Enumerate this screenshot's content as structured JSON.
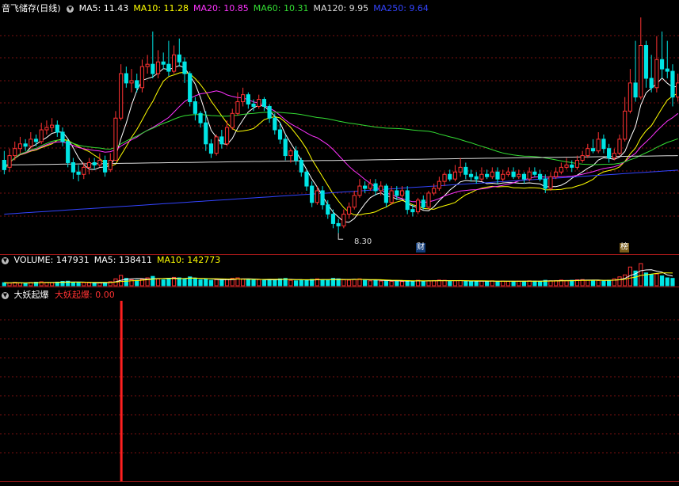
{
  "title": "音飞储存(日线)",
  "ma_legend": [
    {
      "label": "MA5: 11.43",
      "color": "#ffffff"
    },
    {
      "label": "MA10: 11.28",
      "color": "#ffff00"
    },
    {
      "label": "MA20: 10.85",
      "color": "#ff33ff"
    },
    {
      "label": "MA60: 10.31",
      "color": "#33dd33"
    },
    {
      "label": "MA120: 9.95",
      "color": "#dddddd"
    },
    {
      "label": "MA250: 9.64",
      "color": "#3344ff"
    }
  ],
  "low_label": "8.30",
  "markers": {
    "cai": "财",
    "bang": "榜"
  },
  "volume_legend": [
    {
      "label": "VOLUME: 147931",
      "color": "#ffffff"
    },
    {
      "label": "MA5: 138411",
      "color": "#ffffff"
    },
    {
      "label": "MA10: 142773",
      "color": "#ffff00"
    }
  ],
  "indicator_legend": {
    "name": "大妖起爆",
    "value_label": "大妖起爆: 0.00"
  },
  "colors": {
    "up": "#ff3232",
    "down": "#00e5e5",
    "grid": "#7a1010",
    "border": "#a01818"
  },
  "chart_data": [
    {
      "type": "candlestick",
      "title": "音飞储存(日线)",
      "ylim": [
        8.0,
        12.9
      ],
      "low": 8.3,
      "moving_averages": {
        "MA5": 11.43,
        "MA10": 11.28,
        "MA20": 10.85,
        "MA60": 10.31,
        "MA120": 9.95,
        "MA250": 9.64
      },
      "candles": [
        [
          9.85,
          9.65,
          10.05,
          9.55
        ],
        [
          9.7,
          9.95,
          10.1,
          9.6
        ],
        [
          9.95,
          10.1,
          10.25,
          9.85
        ],
        [
          10.1,
          10.2,
          10.35,
          10.0
        ],
        [
          10.2,
          10.15,
          10.3,
          10.05
        ],
        [
          10.15,
          10.3,
          10.45,
          10.1
        ],
        [
          10.3,
          10.25,
          10.4,
          10.15
        ],
        [
          10.25,
          10.5,
          10.65,
          10.2
        ],
        [
          10.5,
          10.55,
          10.7,
          10.4
        ],
        [
          10.55,
          10.6,
          10.75,
          10.45
        ],
        [
          10.6,
          10.45,
          10.7,
          10.35
        ],
        [
          10.45,
          10.25,
          10.55,
          10.15
        ],
        [
          10.25,
          9.8,
          10.3,
          9.7
        ],
        [
          9.8,
          9.6,
          9.9,
          9.45
        ],
        [
          9.6,
          9.55,
          9.75,
          9.4
        ],
        [
          9.55,
          9.7,
          9.8,
          9.45
        ],
        [
          9.7,
          9.8,
          9.9,
          9.55
        ],
        [
          9.8,
          9.75,
          9.9,
          9.65
        ],
        [
          9.75,
          9.85,
          10.0,
          9.7
        ],
        [
          9.85,
          9.6,
          9.95,
          9.5
        ],
        [
          9.65,
          9.85,
          10.0,
          9.6
        ],
        [
          9.85,
          10.75,
          10.9,
          9.85
        ],
        [
          10.75,
          11.7,
          11.9,
          10.7
        ],
        [
          11.7,
          11.5,
          11.85,
          11.4
        ],
        [
          11.5,
          11.55,
          11.8,
          11.3
        ],
        [
          11.55,
          11.4,
          11.7,
          11.3
        ],
        [
          11.4,
          11.85,
          12.0,
          11.3
        ],
        [
          11.85,
          11.9,
          12.1,
          11.7
        ],
        [
          11.9,
          11.7,
          12.6,
          11.6
        ],
        [
          11.7,
          11.95,
          12.2,
          11.6
        ],
        [
          11.95,
          11.9,
          12.15,
          11.8
        ],
        [
          11.9,
          11.75,
          12.4,
          11.65
        ],
        [
          11.75,
          12.1,
          12.3,
          11.7
        ],
        [
          12.1,
          11.95,
          12.45,
          11.85
        ],
        [
          11.95,
          11.7,
          12.05,
          11.5
        ],
        [
          11.7,
          11.1,
          11.75,
          11.0
        ],
        [
          11.1,
          10.85,
          11.2,
          10.7
        ],
        [
          10.85,
          10.65,
          10.9,
          10.55
        ],
        [
          10.65,
          10.2,
          10.9,
          10.05
        ],
        [
          10.2,
          10.0,
          10.3,
          9.9
        ],
        [
          10.0,
          10.35,
          10.4,
          9.95
        ],
        [
          10.35,
          10.2,
          10.5,
          10.1
        ],
        [
          10.2,
          10.55,
          10.7,
          10.15
        ],
        [
          10.55,
          10.85,
          10.95,
          10.5
        ],
        [
          10.85,
          11.1,
          11.3,
          10.8
        ],
        [
          11.1,
          11.25,
          11.4,
          11.0
        ],
        [
          11.25,
          11.05,
          11.3,
          10.95
        ],
        [
          11.05,
          11.0,
          11.15,
          10.9
        ],
        [
          11.0,
          11.15,
          11.25,
          10.95
        ],
        [
          11.15,
          11.0,
          11.2,
          10.9
        ],
        [
          11.0,
          10.75,
          11.05,
          10.65
        ],
        [
          10.75,
          10.5,
          10.85,
          10.4
        ],
        [
          10.5,
          10.3,
          10.65,
          10.2
        ],
        [
          10.3,
          9.95,
          10.4,
          9.85
        ],
        [
          9.95,
          10.05,
          10.1,
          9.8
        ],
        [
          10.05,
          9.85,
          10.15,
          9.75
        ],
        [
          9.85,
          9.6,
          9.9,
          9.5
        ],
        [
          9.6,
          9.3,
          9.65,
          9.2
        ],
        [
          9.3,
          8.95,
          9.4,
          8.85
        ],
        [
          8.95,
          9.2,
          9.3,
          8.9
        ],
        [
          9.2,
          8.9,
          9.3,
          8.8
        ],
        [
          8.9,
          8.7,
          9.0,
          8.6
        ],
        [
          8.7,
          8.5,
          8.8,
          8.4
        ],
        [
          8.5,
          8.45,
          8.6,
          8.3
        ],
        [
          8.45,
          8.7,
          8.8,
          8.4
        ],
        [
          8.7,
          8.85,
          8.95,
          8.6
        ],
        [
          8.85,
          9.1,
          9.2,
          8.8
        ],
        [
          9.1,
          9.3,
          9.45,
          9.05
        ],
        [
          9.3,
          9.25,
          9.4,
          9.15
        ],
        [
          9.25,
          9.35,
          9.45,
          9.2
        ],
        [
          9.35,
          9.2,
          9.45,
          9.1
        ],
        [
          9.2,
          9.3,
          9.4,
          9.1
        ],
        [
          9.3,
          8.95,
          9.35,
          8.85
        ],
        [
          8.95,
          9.2,
          9.3,
          8.9
        ],
        [
          9.2,
          9.1,
          9.3,
          9.0
        ],
        [
          9.1,
          9.2,
          9.3,
          9.05
        ],
        [
          9.2,
          8.8,
          9.3,
          8.7
        ],
        [
          8.8,
          8.75,
          8.9,
          8.65
        ],
        [
          8.75,
          9.0,
          9.05,
          8.7
        ],
        [
          9.0,
          8.85,
          9.1,
          8.8
        ],
        [
          8.85,
          9.15,
          9.2,
          8.8
        ],
        [
          9.15,
          9.25,
          9.35,
          9.1
        ],
        [
          9.25,
          9.4,
          9.5,
          9.2
        ],
        [
          9.4,
          9.55,
          9.6,
          9.3
        ],
        [
          9.55,
          9.45,
          9.65,
          9.4
        ],
        [
          9.45,
          9.6,
          9.75,
          9.4
        ],
        [
          9.6,
          9.7,
          9.9,
          9.5
        ],
        [
          9.7,
          9.55,
          9.8,
          9.45
        ],
        [
          9.55,
          9.5,
          9.65,
          9.4
        ],
        [
          9.5,
          9.45,
          9.6,
          9.35
        ],
        [
          9.45,
          9.55,
          9.7,
          9.4
        ],
        [
          9.55,
          9.5,
          9.65,
          9.45
        ],
        [
          9.5,
          9.6,
          9.7,
          9.45
        ],
        [
          9.6,
          9.45,
          9.7,
          9.35
        ],
        [
          9.45,
          9.55,
          9.65,
          9.4
        ],
        [
          9.55,
          9.6,
          9.7,
          9.5
        ],
        [
          9.6,
          9.5,
          9.7,
          9.45
        ],
        [
          9.5,
          9.55,
          9.65,
          9.45
        ],
        [
          9.55,
          9.45,
          9.6,
          9.35
        ],
        [
          9.45,
          9.6,
          9.7,
          9.4
        ],
        [
          9.6,
          9.55,
          9.7,
          9.5
        ],
        [
          9.55,
          9.45,
          9.65,
          9.4
        ],
        [
          9.45,
          9.25,
          9.55,
          9.15
        ],
        [
          9.25,
          9.5,
          9.6,
          9.2
        ],
        [
          9.5,
          9.6,
          9.7,
          9.45
        ],
        [
          9.6,
          9.7,
          9.8,
          9.55
        ],
        [
          9.7,
          9.75,
          9.9,
          9.65
        ],
        [
          9.75,
          9.7,
          9.85,
          9.6
        ],
        [
          9.7,
          9.85,
          9.95,
          9.65
        ],
        [
          9.85,
          9.95,
          10.05,
          9.8
        ],
        [
          9.95,
          10.1,
          10.2,
          9.9
        ],
        [
          10.1,
          10.05,
          10.3,
          10.0
        ],
        [
          10.05,
          10.3,
          10.45,
          10.0
        ],
        [
          10.3,
          10.1,
          10.4,
          10.0
        ],
        [
          10.1,
          9.9,
          10.2,
          9.8
        ],
        [
          9.9,
          10.0,
          10.1,
          9.85
        ],
        [
          10.0,
          10.3,
          10.4,
          9.95
        ],
        [
          10.3,
          10.9,
          11.2,
          10.25
        ],
        [
          10.9,
          11.5,
          11.8,
          10.85
        ],
        [
          11.5,
          11.2,
          12.4,
          11.1
        ],
        [
          11.2,
          12.3,
          12.9,
          11.15
        ],
        [
          12.3,
          11.6,
          12.4,
          11.4
        ],
        [
          11.6,
          11.4,
          12.1,
          11.3
        ],
        [
          11.4,
          12.0,
          12.5,
          11.3
        ],
        [
          12.0,
          11.8,
          12.6,
          11.6
        ],
        [
          11.8,
          11.75,
          12.4,
          11.6
        ],
        [
          11.75,
          11.2,
          11.9,
          11.0
        ],
        [
          11.2,
          11.5,
          11.7,
          11.1
        ]
      ]
    },
    {
      "type": "bar",
      "title": "VOLUME",
      "values": [
        62,
        55,
        70,
        58,
        48,
        66,
        72,
        80,
        68,
        60,
        74,
        88,
        92,
        70,
        56,
        64,
        60,
        54,
        58,
        66,
        82,
        140,
        210,
        150,
        120,
        110,
        130,
        160,
        190,
        140,
        120,
        150,
        170,
        160,
        130,
        180,
        150,
        120,
        140,
        110,
        125,
        115,
        130,
        150,
        160,
        140,
        120,
        115,
        125,
        110,
        130,
        120,
        140,
        150,
        110,
        100,
        120,
        115,
        130,
        140,
        120,
        110,
        150,
        140,
        120,
        115,
        130,
        140,
        110,
        100,
        115,
        95,
        110,
        90,
        100,
        85,
        105,
        95,
        110,
        90,
        100,
        105,
        115,
        110,
        95,
        100,
        105,
        95,
        90,
        85,
        95,
        90,
        100,
        85,
        95,
        90,
        85,
        95,
        90,
        100,
        95,
        90,
        110,
        100,
        105,
        115,
        100,
        110,
        120,
        125,
        115,
        110,
        105,
        95,
        110,
        140,
        180,
        220,
        380,
        300,
        450,
        260,
        230,
        240,
        200,
        160,
        150
      ],
      "ma_values": {
        "VOLUME": 147931,
        "MA5": 138411,
        "MA10": 142773
      }
    },
    {
      "type": "bar",
      "title": "大妖起爆",
      "values": [
        0,
        0,
        0,
        0,
        0,
        0,
        0,
        0,
        0,
        0,
        0,
        0,
        0,
        0,
        0,
        0,
        0,
        0,
        0,
        0,
        0,
        0,
        1,
        0,
        0,
        0,
        0,
        0,
        0,
        0,
        0,
        0,
        0,
        0,
        0,
        0,
        0,
        0,
        0,
        0,
        0,
        0,
        0,
        0,
        0,
        0,
        0,
        0,
        0,
        0,
        0,
        0,
        0,
        0,
        0,
        0,
        0,
        0,
        0,
        0,
        0,
        0,
        0,
        0,
        0,
        0,
        0,
        0,
        0,
        0,
        0,
        0,
        0,
        0,
        0,
        0,
        0,
        0,
        0,
        0,
        0,
        0,
        0,
        0,
        0,
        0,
        0,
        0,
        0,
        0,
        0,
        0,
        0,
        0,
        0,
        0,
        0,
        0,
        0,
        0,
        0,
        0,
        0,
        0,
        0,
        0,
        0,
        0,
        0,
        0,
        0,
        0,
        0,
        0,
        0,
        0,
        0,
        0,
        0,
        0,
        0,
        0,
        0,
        0,
        0,
        0,
        0
      ],
      "current_value": 0.0
    }
  ]
}
